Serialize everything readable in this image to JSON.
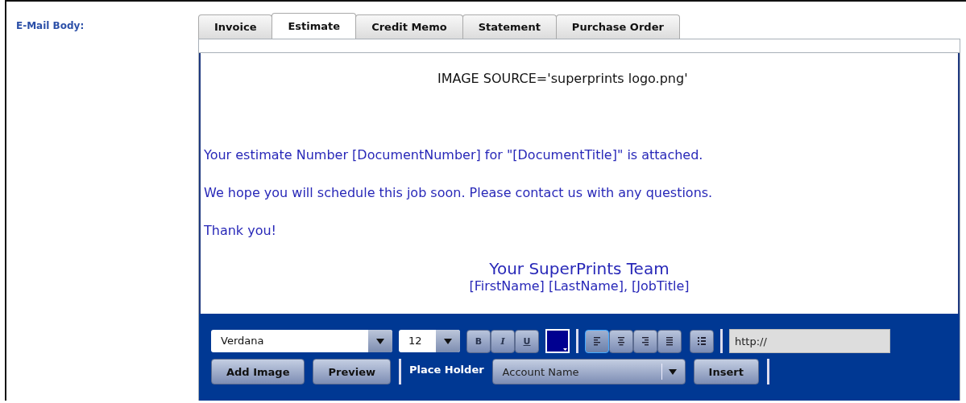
{
  "field_label": "E-Mail Body:",
  "tabs": [
    {
      "label": "Invoice",
      "selected": false
    },
    {
      "label": "Estimate",
      "selected": true
    },
    {
      "label": "Credit Memo",
      "selected": false
    },
    {
      "label": "Statement",
      "selected": false
    },
    {
      "label": "Purchase Order",
      "selected": false
    }
  ],
  "body": [
    {
      "kind": "image_ref",
      "text": "IMAGE SOURCE='superprints logo.png'"
    },
    {
      "kind": "paragraph",
      "text": "Your estimate Number [DocumentNumber] for \"[DocumentTitle]\" is attached."
    },
    {
      "kind": "paragraph",
      "text": "We hope you will schedule this job soon. Please contact us with any questions."
    },
    {
      "kind": "paragraph",
      "text": "Thank you!"
    },
    {
      "kind": "signature_title",
      "text": "Your SuperPrints Team"
    },
    {
      "kind": "signature_line",
      "text": "[FirstName] [LastName], [JobTitle]"
    }
  ],
  "toolbar": {
    "font": "Verdana",
    "size": "12",
    "format_buttons": [
      "B",
      "I",
      "U"
    ],
    "alignment": [
      {
        "selected": true
      },
      {
        "selected": false
      },
      {
        "selected": false
      },
      {
        "selected": false
      }
    ],
    "url_field": {
      "value": "http://"
    },
    "buttons": [
      "Add Image",
      "Preview"
    ],
    "placeholder_label": "Place Holder",
    "placeholder_select": "Account Name",
    "insert_button": "Insert"
  }
}
